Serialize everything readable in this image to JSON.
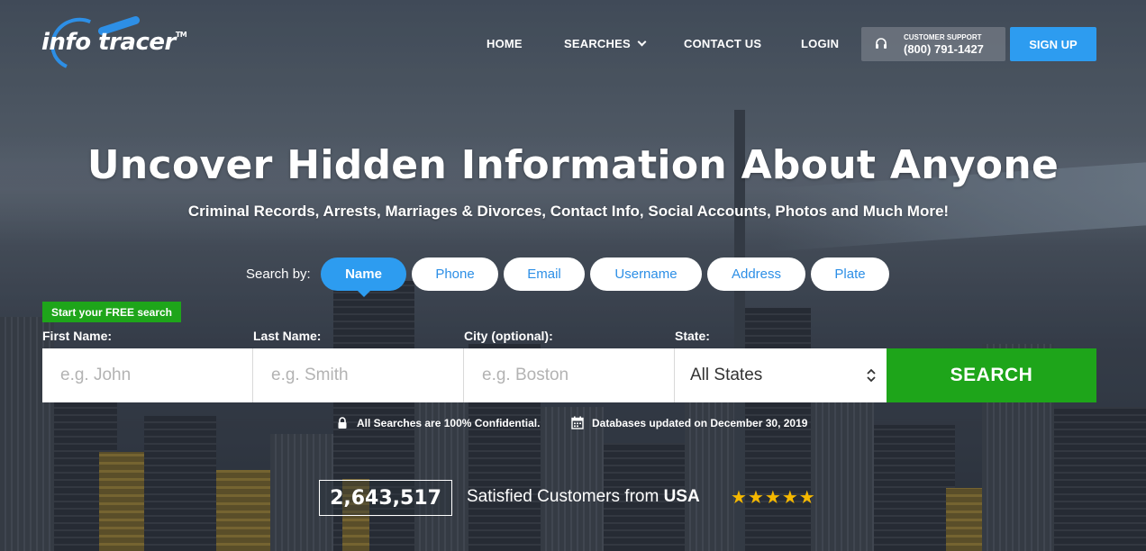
{
  "brand": {
    "logo_left": "info",
    "logo_right": "tracer",
    "trademark": "TM"
  },
  "nav": {
    "items": [
      {
        "label": "HOME"
      },
      {
        "label": "SEARCHES"
      },
      {
        "label": "CONTACT US"
      },
      {
        "label": "LOGIN"
      }
    ],
    "support_label": "CUSTOMER SUPPORT",
    "support_phone": "(800) 791-1427",
    "signup_label": "SIGN UP"
  },
  "hero": {
    "title": "Uncover Hidden Information About Anyone",
    "subtitle": "Criminal Records, Arrests, Marriages & Divorces, Contact Info, Social Accounts, Photos and Much More!"
  },
  "search_by": {
    "label": "Search by:",
    "tabs": [
      {
        "label": "Name",
        "active": true
      },
      {
        "label": "Phone",
        "active": false
      },
      {
        "label": "Email",
        "active": false
      },
      {
        "label": "Username",
        "active": false
      },
      {
        "label": "Address",
        "active": false
      },
      {
        "label": "Plate",
        "active": false
      }
    ]
  },
  "form": {
    "free_badge": "Start your FREE search",
    "first_name": {
      "label": "First Name:",
      "placeholder": "e.g. John",
      "value": ""
    },
    "last_name": {
      "label": "Last Name:",
      "placeholder": "e.g. Smith",
      "value": ""
    },
    "city": {
      "label": "City (optional):",
      "placeholder": "e.g. Boston",
      "value": ""
    },
    "state": {
      "label": "State:",
      "selected": "All States"
    },
    "search_button": "SEARCH"
  },
  "notes": {
    "confidential": "All Searches are 100% Confidential.",
    "updated": "Databases updated on December 30, 2019"
  },
  "stats": {
    "count": "2,643,517",
    "text": "Satisfied Customers from ",
    "country": "USA",
    "stars": 5
  },
  "colors": {
    "accent_blue": "#2d9cf0",
    "search_green": "#1ea51a",
    "star_gold": "#f5b800"
  }
}
